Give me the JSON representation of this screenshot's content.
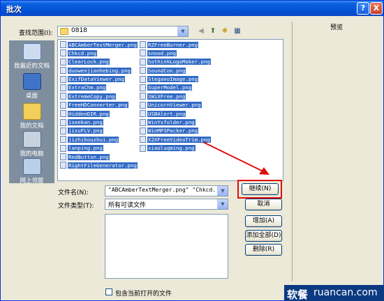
{
  "window": {
    "title": "批次",
    "help_button": "?",
    "close_button": "X"
  },
  "look_in": {
    "label": "查找范围(I):",
    "value": "0818"
  },
  "toolbar_icons": [
    "back-icon",
    "up-folder-icon",
    "new-folder-icon",
    "view-menu-icon"
  ],
  "places": [
    {
      "label": "我最近的文档",
      "icon": "recent-docs-icon"
    },
    {
      "label": "桌面",
      "icon": "desktop-icon"
    },
    {
      "label": "我的文档",
      "icon": "my-documents-icon"
    },
    {
      "label": "我的电脑",
      "icon": "my-computer-icon"
    },
    {
      "label": "网上邻居",
      "icon": "network-icon"
    }
  ],
  "files_col1": [
    "ABCAmberTextMerger.png",
    "Chkcd.png",
    "ClearLock.png",
    "duowenjianhebing.png",
    "ExifDataViewer.png",
    "ExtraChm.png",
    "ExtremeCopy.png",
    "FreeHDConverter.png",
    "HiddenDIR.png",
    "iseekan.png",
    "jisuFLV.png",
    "jizhihouzhui.png",
    "lanping.png",
    "RedButton.png",
    "RightFileGenerator.png"
  ],
  "files_col2": [
    "RZFreeBurner.png",
    "snood.png",
    "SothinkLogoMaker.png",
    "SoundCon.png",
    "SteganoImage.png",
    "SuperModel.png",
    "SWiXFree.png",
    "UnicornViewer.png",
    "USBAlert.png",
    "WinYxfolder.png",
    "WinMP3Packer.png",
    "X2XFreeVideoTrim.png",
    "xiaoluqming.png"
  ],
  "filename": {
    "label": "文件名(N):",
    "value": "\"ABCAmberTextMerger.png\" \"Chkcd.png\" \""
  },
  "filetype": {
    "label": "文件类型(T):",
    "value": "所有可读文件"
  },
  "buttons": {
    "continue": "继续(N)",
    "cancel": "取消",
    "add": "增加(A)",
    "add_all": "添加全部(D)",
    "delete": "删除(R)"
  },
  "preview_label": "预览",
  "include_checkbox": "包含当前打开的文件",
  "watermark": {
    "cn": "软餐",
    "en": "ruancan.com"
  },
  "colors": {
    "selection": "#316ac5",
    "title_bar": "#0453d6",
    "highlight": "#e00d0d",
    "watermark_bg": "#0c3a82"
  }
}
